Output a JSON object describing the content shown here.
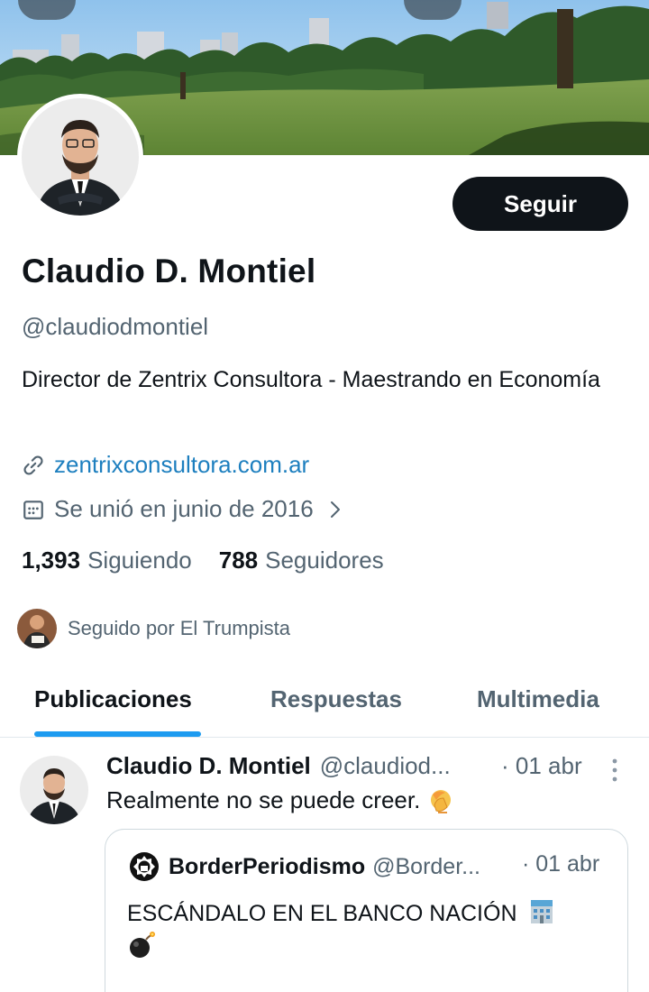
{
  "profile": {
    "name": "Claudio D. Montiel",
    "handle": "@claudiodmontiel",
    "bio": "Director de Zentrix Consultora - Maestrando en Economía",
    "website": "zentrixconsultora.com.ar",
    "joined": "Se unió en junio de 2016",
    "following_count": "1,393",
    "following_label": "Siguiendo",
    "followers_count": "788",
    "followers_label": "Seguidores",
    "followed_by": "Seguido por El Trumpista"
  },
  "actions": {
    "follow_label": "Seguir"
  },
  "tabs": [
    {
      "label": "Publicaciones",
      "active": true
    },
    {
      "label": "Respuestas",
      "active": false
    },
    {
      "label": "Multimedia",
      "active": false
    }
  ],
  "tweet": {
    "author_name": "Claudio D. Montiel",
    "author_handle": "@claudiod...",
    "date": "· 01 abr",
    "text": "Realmente no se puede creer.",
    "quote": {
      "author_name": "BorderPeriodismo",
      "author_handle": "@Border...",
      "date": "· 01 abr",
      "text": "ESCÁNDALO EN EL BANCO NACIÓN"
    }
  },
  "icons": {
    "link": "link-icon",
    "calendar": "calendar-icon",
    "chevron": "chevron-right-icon",
    "more": "more-vertical-icon",
    "facepalm": "facepalm-emoji",
    "bank": "bank-emoji",
    "bomb": "bomb-emoji"
  },
  "colors": {
    "accent": "#1d9bf0",
    "link": "#1d7fbf",
    "secondary_text": "#536471",
    "button_bg": "#0f1419"
  }
}
